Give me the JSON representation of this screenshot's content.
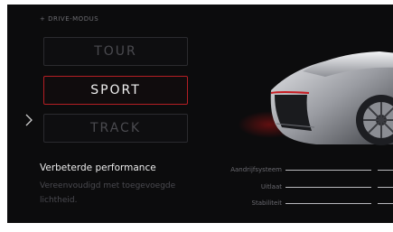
{
  "header": {
    "title": "+ DRIVE-MODUS"
  },
  "modes": [
    {
      "label": "TOUR",
      "active": false
    },
    {
      "label": "SPORT",
      "active": true
    },
    {
      "label": "TRACK",
      "active": false
    }
  ],
  "description": {
    "title": "Verbeterde performance",
    "subtitle": "Vereenvoudigd met toegevoegde lichtheid."
  },
  "metrics": [
    {
      "label": "Aandrijfsysteem"
    },
    {
      "label": "Uitlaat"
    },
    {
      "label": "Stabiliteit"
    }
  ],
  "colors": {
    "accent": "#b41e24",
    "background": "#0c0c0d"
  },
  "icons": {
    "prev": "chevron-right-icon"
  }
}
